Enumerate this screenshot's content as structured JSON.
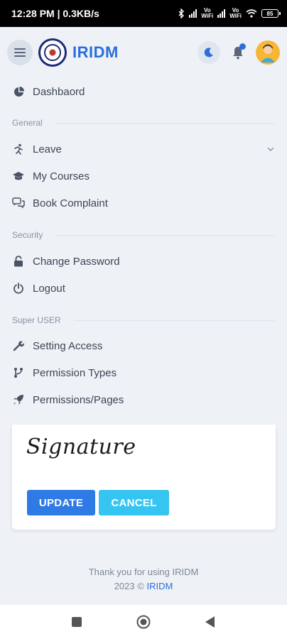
{
  "status_bar": {
    "time_speed": "12:28 PM | 0.3KB/s",
    "net1": "Vo\nWiFi",
    "net2": "Vo\nWiFi",
    "battery": "85"
  },
  "header": {
    "brand": "IRIDM"
  },
  "menu": {
    "dashboard": "Dashbaord",
    "section_general": "General",
    "leave": "Leave",
    "my_courses": "My Courses",
    "book_complaint": "Book Complaint",
    "section_security": "Security",
    "change_password": "Change Password",
    "logout": "Logout",
    "section_super_user": "Super USER",
    "setting_access": "Setting Access",
    "permission_types": "Permission Types",
    "permissions_pages": "Permissions/Pages"
  },
  "card": {
    "signature": "Signature",
    "update_label": "UPDATE",
    "cancel_label": "CANCEL"
  },
  "footer": {
    "thanks": "Thank you for using IRIDM",
    "year": "2023 ©",
    "brand_link": "IRIDM"
  },
  "colors": {
    "accent": "#2a6fdb",
    "update_btn": "#2f7be5",
    "cancel_btn": "#36c5f0",
    "background": "#eef2f7"
  }
}
